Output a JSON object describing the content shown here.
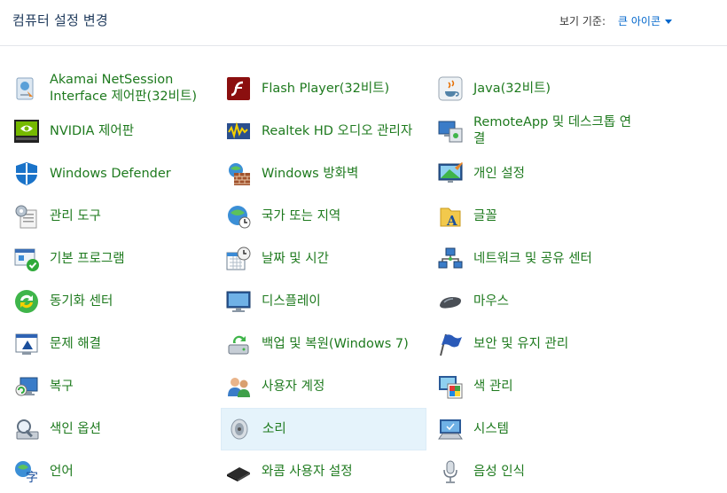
{
  "header": {
    "title": "컴퓨터 설정 변경",
    "view_by_label": "보기 기준:",
    "view_by_value": "큰 아이콘"
  },
  "columns": [
    [
      {
        "label": "Akamai NetSession Interface 제어판(32비트)",
        "icon": "akamai-icon"
      },
      {
        "label": "NVIDIA 제어판",
        "icon": "nvidia-icon"
      },
      {
        "label": "Windows Defender",
        "icon": "shield-icon"
      },
      {
        "label": "관리 도구",
        "icon": "admin-tools-icon"
      },
      {
        "label": "기본 프로그램",
        "icon": "default-programs-icon"
      },
      {
        "label": "동기화 센터",
        "icon": "sync-icon"
      },
      {
        "label": "문제 해결",
        "icon": "troubleshoot-icon"
      },
      {
        "label": "복구",
        "icon": "recovery-icon"
      },
      {
        "label": "색인 옵션",
        "icon": "indexing-icon"
      },
      {
        "label": "언어",
        "icon": "language-icon"
      }
    ],
    [
      {
        "label": "Flash Player(32비트)",
        "icon": "flash-icon"
      },
      {
        "label": "Realtek HD 오디오 관리자",
        "icon": "realtek-icon"
      },
      {
        "label": "Windows 방화벽",
        "icon": "firewall-icon"
      },
      {
        "label": "국가 또는 지역",
        "icon": "globe-clock-icon"
      },
      {
        "label": "날짜 및 시간",
        "icon": "calendar-clock-icon"
      },
      {
        "label": "디스플레이",
        "icon": "display-icon"
      },
      {
        "label": "백업 및 복원(Windows 7)",
        "icon": "backup-icon"
      },
      {
        "label": "사용자 계정",
        "icon": "users-icon"
      },
      {
        "label": "소리",
        "icon": "speaker-icon"
      },
      {
        "label": "와콤 사용자 설정",
        "icon": "wacom-icon"
      }
    ],
    [
      {
        "label": "Java(32비트)",
        "icon": "java-icon"
      },
      {
        "label": "RemoteApp 및 데스크톱 연결",
        "icon": "remoteapp-icon"
      },
      {
        "label": "개인 설정",
        "icon": "personalize-icon"
      },
      {
        "label": "글꼴",
        "icon": "fonts-icon"
      },
      {
        "label": "네트워크 및 공유 센터",
        "icon": "network-icon"
      },
      {
        "label": "마우스",
        "icon": "mouse-icon"
      },
      {
        "label": "보안 및 유지 관리",
        "icon": "flag-icon"
      },
      {
        "label": "색 관리",
        "icon": "color-icon"
      },
      {
        "label": "시스템",
        "icon": "system-icon"
      },
      {
        "label": "음성 인식",
        "icon": "microphone-icon"
      }
    ]
  ],
  "hovered_item": "소리"
}
